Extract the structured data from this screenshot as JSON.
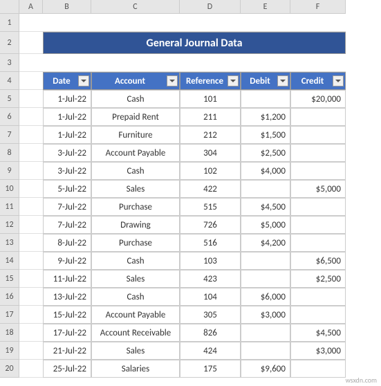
{
  "columns": [
    "A",
    "B",
    "C",
    "D",
    "E",
    "F"
  ],
  "title": "General Journal Data",
  "headers": {
    "date": "Date",
    "account": "Account",
    "reference": "Reference",
    "debit": "Debit",
    "credit": "Credit"
  },
  "rows": [
    {
      "date": "1-Jul-22",
      "account": "Cash",
      "reference": "101",
      "debit": "",
      "credit": "$20,000"
    },
    {
      "date": "1-Jul-22",
      "account": "Prepaid Rent",
      "reference": "211",
      "debit": "$1,200",
      "credit": ""
    },
    {
      "date": "1-Jul-22",
      "account": "Furniture",
      "reference": "212",
      "debit": "$1,500",
      "credit": ""
    },
    {
      "date": "3-Jul-22",
      "account": "Account Payable",
      "reference": "304",
      "debit": "$2,500",
      "credit": ""
    },
    {
      "date": "3-Jul-22",
      "account": "Cash",
      "reference": "102",
      "debit": "$4,000",
      "credit": ""
    },
    {
      "date": "5-Jul-22",
      "account": "Sales",
      "reference": "422",
      "debit": "",
      "credit": "$5,000"
    },
    {
      "date": "7-Jul-22",
      "account": "Purchase",
      "reference": "515",
      "debit": "$4,500",
      "credit": ""
    },
    {
      "date": "7-Jul-22",
      "account": "Drawing",
      "reference": "726",
      "debit": "$5,000",
      "credit": ""
    },
    {
      "date": "8-Jul-22",
      "account": "Purchase",
      "reference": "516",
      "debit": "$4,200",
      "credit": ""
    },
    {
      "date": "9-Jul-22",
      "account": "Cash",
      "reference": "103",
      "debit": "",
      "credit": "$6,500"
    },
    {
      "date": "11-Jul-22",
      "account": "Sales",
      "reference": "423",
      "debit": "",
      "credit": "$2,500"
    },
    {
      "date": "13-Jul-22",
      "account": "Cash",
      "reference": "104",
      "debit": "$6,000",
      "credit": ""
    },
    {
      "date": "15-Jul-22",
      "account": "Account Payable",
      "reference": "305",
      "debit": "$3,000",
      "credit": ""
    },
    {
      "date": "17-Jul-22",
      "account": "Account Receivable",
      "reference": "826",
      "debit": "",
      "credit": "$4,500"
    },
    {
      "date": "21-Jul-22",
      "account": "Sales",
      "reference": "424",
      "debit": "",
      "credit": "$3,000"
    },
    {
      "date": "25-Jul-22",
      "account": "Salaries",
      "reference": "175",
      "debit": "$9,600",
      "credit": ""
    }
  ],
  "watermark": "wsxdn.com"
}
